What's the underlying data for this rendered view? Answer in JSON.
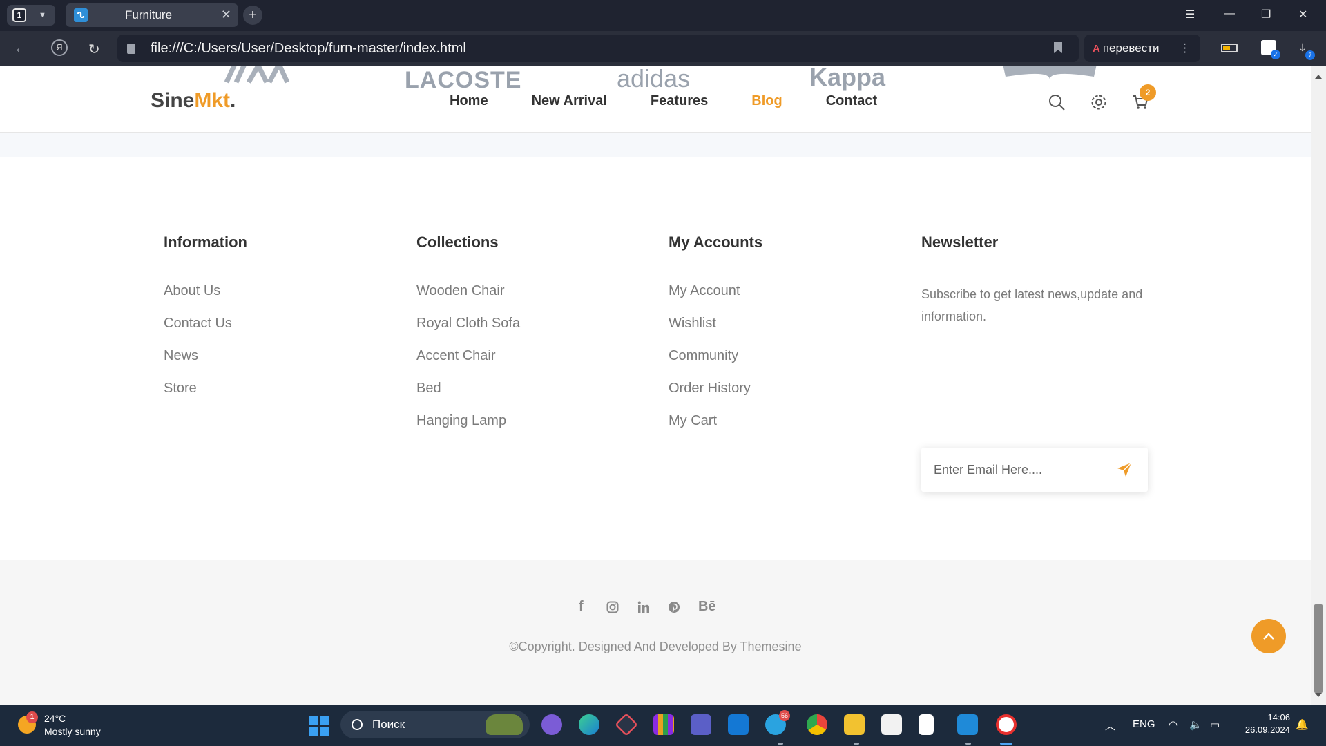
{
  "browser": {
    "tab_count": "1",
    "tab_title": "Furniture",
    "url": "file:///C:/Users/User/Desktop/furn-master/index.html",
    "translate_label": "перевести",
    "translate_icon_text": "A",
    "downloads_badge": "7"
  },
  "brand_strip": [
    "LACOSTE",
    "adidas",
    "Kappa"
  ],
  "header": {
    "logo_main": "Sine",
    "logo_accent": "Mkt",
    "logo_dot": ".",
    "nav": [
      {
        "label": "Home",
        "active": false
      },
      {
        "label": "New Arrival",
        "active": false
      },
      {
        "label": "Features",
        "active": false
      },
      {
        "label": "Blog",
        "active": true
      },
      {
        "label": "Contact",
        "active": false
      }
    ],
    "cart_count": "2"
  },
  "footer": {
    "information": {
      "title": "Information",
      "links": [
        "About Us",
        "Contact Us",
        "News",
        "Store"
      ]
    },
    "collections": {
      "title": "Collections",
      "links": [
        "Wooden Chair",
        "Royal Cloth Sofa",
        "Accent Chair",
        "Bed",
        "Hanging Lamp"
      ]
    },
    "accounts": {
      "title": "My Accounts",
      "links": [
        "My Account",
        "Wishlist",
        "Community",
        "Order History",
        "My Cart"
      ]
    },
    "newsletter": {
      "title": "Newsletter",
      "text": "Subscribe to get latest news,update and information.",
      "placeholder": "Enter Email Here...."
    },
    "socials": [
      "f",
      "Bē"
    ],
    "copyright": "©Copyright. Designed And Developed By Themesine"
  },
  "colors": {
    "accent": "#ef9b28",
    "chrome_dark": "#1f2330",
    "taskbar": "#1c2a3c"
  },
  "taskbar": {
    "weather_badge": "1",
    "temperature": "24°C",
    "condition": "Mostly sunny",
    "search_label": "Поиск",
    "telegram_badge": "56",
    "language": "ENG",
    "time": "14:06",
    "date": "26.09.2024"
  }
}
